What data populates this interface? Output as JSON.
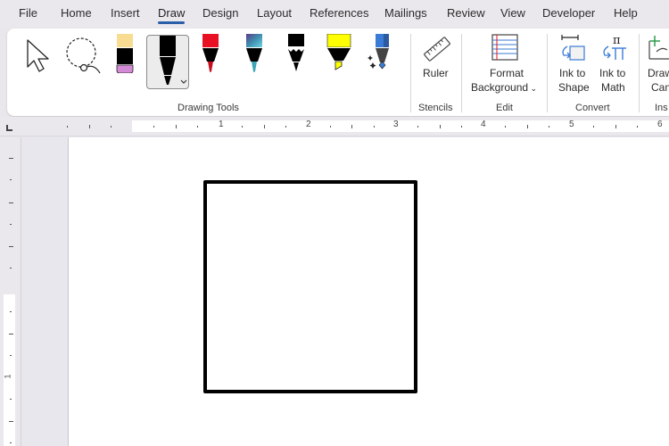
{
  "menu": {
    "tabs": [
      {
        "label": "File"
      },
      {
        "label": "Home"
      },
      {
        "label": "Insert"
      },
      {
        "label": "Draw",
        "active": true
      },
      {
        "label": "Design"
      },
      {
        "label": "Layout"
      },
      {
        "label": "References"
      },
      {
        "label": "Mailings"
      },
      {
        "label": "Review"
      },
      {
        "label": "View"
      },
      {
        "label": "Developer"
      },
      {
        "label": "Help"
      }
    ]
  },
  "ribbon": {
    "groups": {
      "drawing_tools": "Drawing Tools",
      "stencils": "Stencils",
      "edit": "Edit",
      "convert": "Convert",
      "insert": "Ins"
    },
    "tools": {
      "select": "select-pointer-icon",
      "lasso": "lasso-select-icon",
      "eraser": "eraser-icon",
      "pen_black": "black-pen-icon",
      "pen_red": "red-pen-icon",
      "pen_galaxy": "galaxy-pen-icon",
      "pencil": "black-pencil-icon",
      "highlighter": "yellow-highlighter-icon",
      "action_pen": "action-pen-icon"
    },
    "buttons": {
      "ruler": "Ruler",
      "format_bg_line1": "Format",
      "format_bg_line2": "Background",
      "ink_to_shape_line1": "Ink to",
      "ink_to_shape_line2": "Shape",
      "ink_to_math_line1": "Ink to",
      "ink_to_math_line2": "Math",
      "drawing_canvas_line1": "Draw",
      "drawing_canvas_line2": "Can"
    },
    "colors": {
      "pen_red": "#e81123",
      "highlighter": "#ffff00",
      "eraser_top": "#f7dc91",
      "eraser_bottom": "#d48bd6",
      "action_pen": "#3a7bd5",
      "accent": "#2a5ea8"
    }
  },
  "ruler": {
    "top_numbers": [
      "1",
      "2",
      "3",
      "4",
      "5",
      "6"
    ],
    "left_numbers": [
      "1"
    ]
  },
  "document": {
    "shape": "square-ink-drawing"
  }
}
